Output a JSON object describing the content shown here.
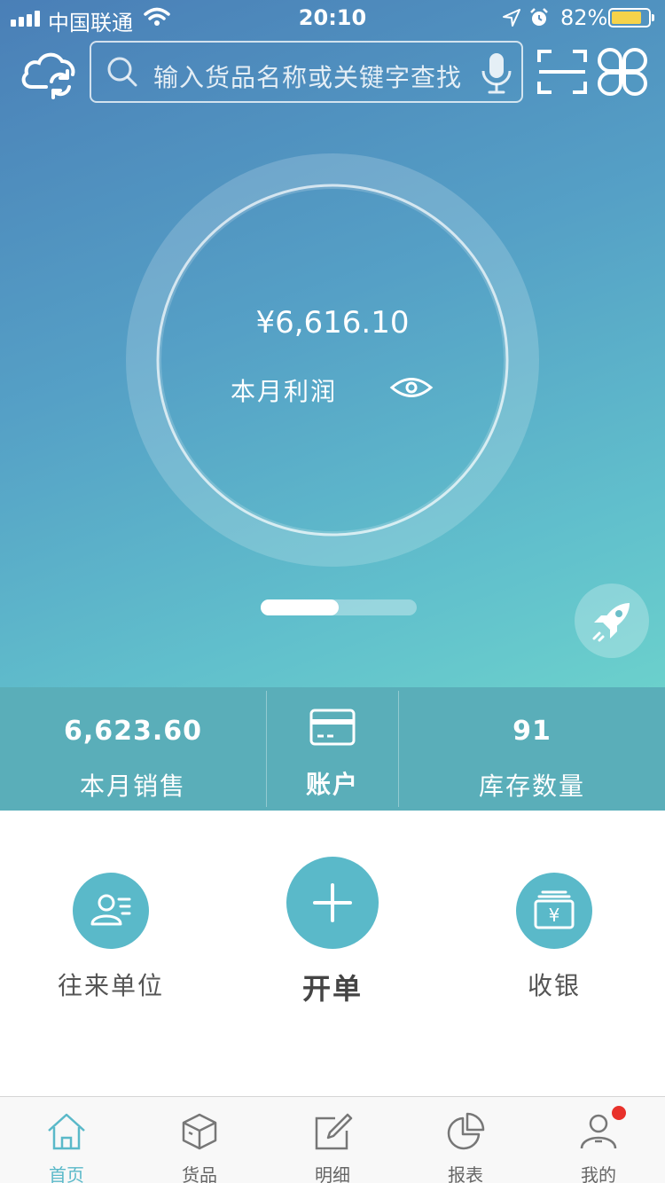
{
  "status_bar": {
    "carrier": "中国联通",
    "time": "20:10",
    "battery_percent": "82%",
    "battery_level": 0.82
  },
  "search": {
    "placeholder": "输入货品名称或关键字查找"
  },
  "profit": {
    "amount": "¥6,616.10",
    "label": "本月利润"
  },
  "carousel": {
    "current_page": 1,
    "total_pages": 2
  },
  "stats": {
    "sales_value": "6,623.60",
    "sales_label": "本月销售",
    "account_label": "账户",
    "stock_value": "91",
    "stock_label": "库存数量"
  },
  "actions": {
    "partners_label": "往来单位",
    "new_order_label": "开单",
    "cashier_label": "收银"
  },
  "tabbar": {
    "items": [
      {
        "label": "首页",
        "icon": "home-icon",
        "active": true
      },
      {
        "label": "货品",
        "icon": "box-icon",
        "active": false
      },
      {
        "label": "明细",
        "icon": "edit-icon",
        "active": false
      },
      {
        "label": "报表",
        "icon": "pie-chart-icon",
        "active": false
      },
      {
        "label": "我的",
        "icon": "user-icon",
        "active": false,
        "badge": true
      }
    ]
  },
  "colors": {
    "accent": "#5ab9c9",
    "stats_strip": "#5aaeb9",
    "battery_fill": "#f5d34a",
    "badge": "#e8312b"
  }
}
